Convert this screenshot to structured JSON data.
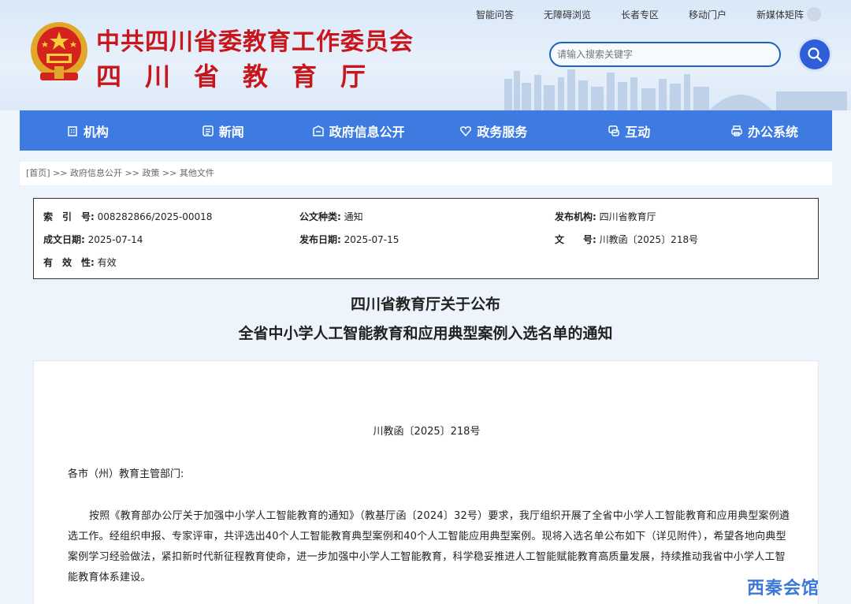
{
  "header": {
    "title_line1": "中共四川省委教育工作委员会",
    "title_line2": "四川省教育厅",
    "top_links": [
      "智能问答",
      "无障碍浏览",
      "长者专区",
      "移动门户",
      "新媒体矩阵"
    ],
    "search_placeholder": "请输入搜索关键字"
  },
  "nav": {
    "items": [
      {
        "label": "机构",
        "icon": "building-icon"
      },
      {
        "label": "新闻",
        "icon": "news-icon"
      },
      {
        "label": "政府信息公开",
        "icon": "info-icon"
      },
      {
        "label": "政务服务",
        "icon": "service-icon"
      },
      {
        "label": "互动",
        "icon": "chat-icon"
      },
      {
        "label": "办公系统",
        "icon": "printer-icon"
      }
    ]
  },
  "breadcrumb": {
    "home": "[首页]",
    "sep": " >> ",
    "items": [
      "政府信息公开",
      "政策",
      "其他文件"
    ]
  },
  "meta": {
    "index_label": "索　引　号:",
    "index_value": "008282866/2025-00018",
    "type_label": "公文种类:",
    "type_value": "通知",
    "org_label": "发布机构:",
    "org_value": "四川省教育厅",
    "date_label": "成文日期:",
    "date_value": "2025-07-14",
    "pub_label": "发布日期:",
    "pub_value": "2025-07-15",
    "docno_label": "文　　号:",
    "docno_value": "川教函〔2025〕218号",
    "valid_label": "有　效　性:",
    "valid_value": "有效"
  },
  "doc": {
    "title_line1": "四川省教育厅关于公布",
    "title_line2": "全省中小学人工智能教育和应用典型案例入选名单的通知",
    "number": "川教函〔2025〕218号",
    "addressee": "各市（州）教育主管部门:",
    "paragraph": "按照《教育部办公厅关于加强中小学人工智能教育的通知》（教基厅函〔2024〕32号）要求，我厅组织开展了全省中小学人工智能教育和应用典型案例遴选工作。经组织申报、专家评审，共评选出40个人工智能教育典型案例和40个人工智能应用典型案例。现将入选名单公布如下（详见附件），希望各地向典型案例学习经验做法，紧扣新时代新征程教育使命，进一步加强中小学人工智能教育，科学稳妥推进人工智能赋能教育高质量发展，持续推动我省中小学人工智能教育体系建设。"
  },
  "watermark": "西秦会馆",
  "colors": {
    "brand_red": "#c8161d",
    "nav_blue": "#3d7be0",
    "accent_blue": "#2e5ed8"
  }
}
